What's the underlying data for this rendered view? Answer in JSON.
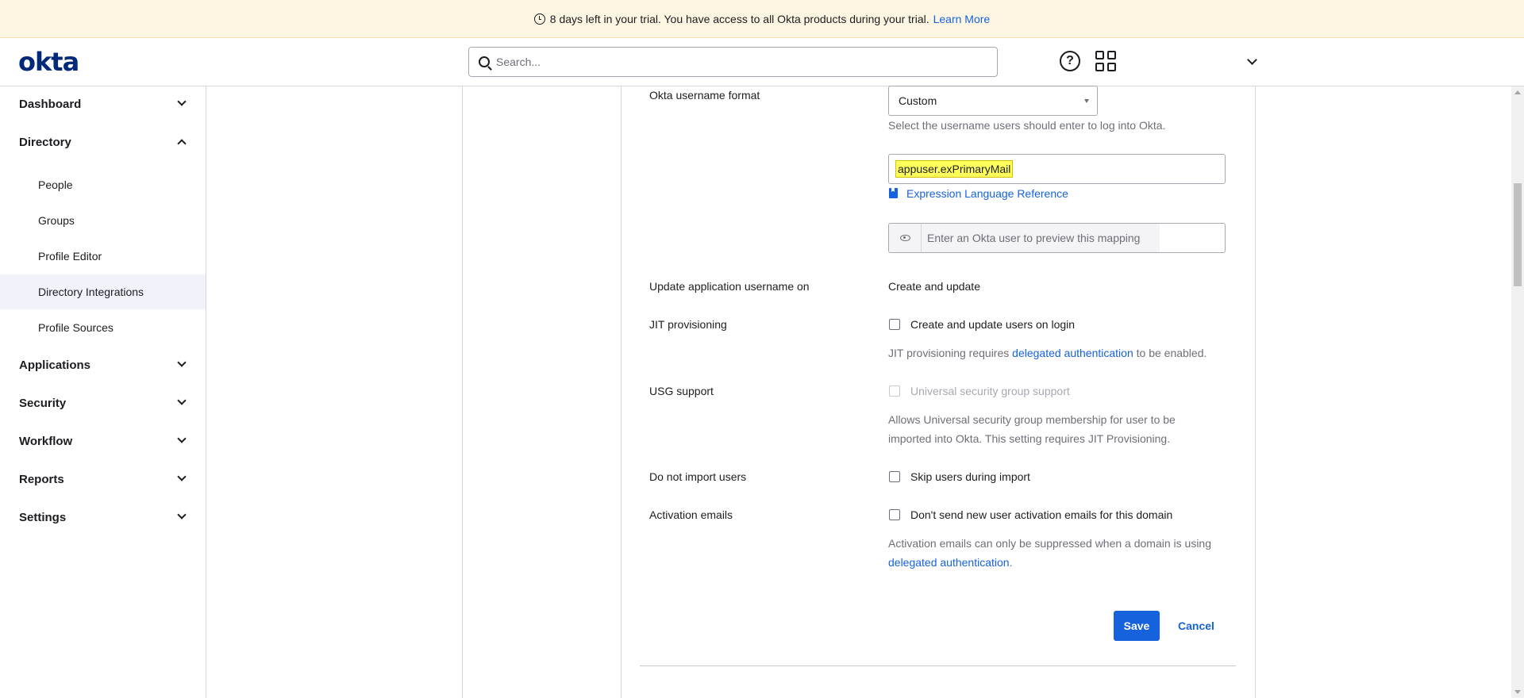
{
  "banner": {
    "icon": "clock-icon",
    "text": "8 days left in your trial. You have access to all Okta products during your trial.",
    "link": "Learn More"
  },
  "header": {
    "logo": "okta",
    "search_placeholder": "Search...",
    "help_glyph": "?"
  },
  "sidebar": {
    "dashboard": "Dashboard",
    "directory": "Directory",
    "directory_items": [
      "People",
      "Groups",
      "Profile Editor",
      "Directory Integrations",
      "Profile Sources"
    ],
    "applications": "Applications",
    "security": "Security",
    "workflow": "Workflow",
    "reports": "Reports",
    "settings": "Settings"
  },
  "form": {
    "username_format": {
      "label": "Okta username format",
      "selected": "Custom",
      "help": "Select the username users should enter to log into Okta.",
      "expression": "appuser.exPrimaryMail",
      "expression_link": "Expression Language Reference",
      "preview_placeholder": "Enter an Okta user to preview this mapping"
    },
    "update_username": {
      "label": "Update application username on",
      "value": "Create and update"
    },
    "jit": {
      "label": "JIT provisioning",
      "checkbox": "Create and update users on login",
      "help_prefix": "JIT provisioning requires",
      "help_link": "delegated authentication",
      "help_suffix": "to be enabled."
    },
    "usg": {
      "label": "USG support",
      "checkbox": "Universal security group support",
      "help_line1": "Allows Universal security group membership for user to be",
      "help_line2": "imported into Okta. This setting requires JIT Provisioning."
    },
    "no_import": {
      "label": "Do not import users",
      "checkbox": "Skip users during import"
    },
    "activation": {
      "label": "Activation emails",
      "checkbox": "Don't send new user activation emails for this domain",
      "help_line1": "Activation emails can only be suppressed when a domain is using",
      "help_link": "delegated authentication",
      "help_suffix": "."
    },
    "save": "Save",
    "cancel": "Cancel"
  },
  "colors": {
    "accent": "#1662dd",
    "banner_bg": "#fcf5e2",
    "highlight": "#ffff5c",
    "logo": "#00297a"
  }
}
